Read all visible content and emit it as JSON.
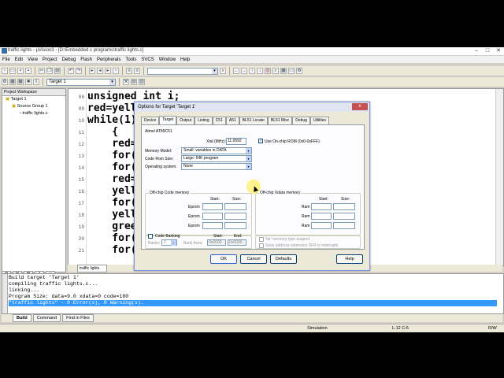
{
  "window": {
    "title": "traffic lights - µVision3 - [D:\\Embedded c programs\\traffic lights.c]"
  },
  "menu": [
    "File",
    "Edit",
    "View",
    "Project",
    "Debug",
    "Flash",
    "Peripherals",
    "Tools",
    "SVCS",
    "Window",
    "Help"
  ],
  "toolbar": {
    "target": "Target 1"
  },
  "workspace": {
    "title": "Project Workspace",
    "tree": [
      "Target 1",
      "Source Group 1",
      "traffic lights.c"
    ]
  },
  "editor": {
    "tab": "traffic lights",
    "lines": [
      {
        "num": "08",
        "text": "unsigned int i;"
      },
      {
        "num": "09",
        "text": "red=yell"
      },
      {
        "num": "10",
        "text": "while(1)"
      },
      {
        "num": "11",
        "text": "    {"
      },
      {
        "num": "12",
        "text": "    red="
      },
      {
        "num": "13",
        "text": "    for("
      },
      {
        "num": "14",
        "text": "    for("
      },
      {
        "num": "15",
        "text": "    red="
      },
      {
        "num": "16",
        "text": "    yell"
      },
      {
        "num": "17",
        "text": "    for("
      },
      {
        "num": "18",
        "text": "    yell"
      },
      {
        "num": "19",
        "text": "    gree"
      },
      {
        "num": "20",
        "text": "    for("
      },
      {
        "num": "21",
        "text": "    for("
      }
    ]
  },
  "output": {
    "lines": [
      "Build target 'Target 1'",
      "compiling traffic lights.c...",
      "linking...",
      "Program Size: data=9.0 xdata=0 code=180",
      "\"traffic lights\" - 0 Error(s), 0 Warning(s)."
    ],
    "tabs": [
      "Build",
      "Command",
      "Find in Files"
    ]
  },
  "status": {
    "mode": "Simulation",
    "pos": "L:12 C:6",
    "extra": "R/W"
  },
  "dialog": {
    "title": "Options for Target 'Target 1'",
    "close": "x",
    "tabs": [
      "Device",
      "Target",
      "Output",
      "Listing",
      "C51",
      "A51",
      "BL51 Locate",
      "BL51 Misc",
      "Debug",
      "Utilities"
    ],
    "active_tab": "Target",
    "device": "Atmel AT89C51",
    "xtal_label": "Xtal (MHz):",
    "xtal_value": "11.0592",
    "onchip_rom": "Use On-chip ROM (0x0-0xFFF)",
    "memory_model_label": "Memory Model:",
    "memory_model": "Small: variables in DATA",
    "code_rom_label": "Code Rom Size:",
    "code_rom": "Large: 64K program",
    "os_label": "Operating system:",
    "os": "None",
    "offchip_code": "Off-chip Code memory",
    "offchip_xdata": "Off-chip Xdata memory",
    "start": "Start:",
    "size": "Size:",
    "eprom": "Eprom",
    "ram": "Ram",
    "code_banking": "Code Banking",
    "banks_label": "Banks:",
    "banks_value": "2",
    "bank_area_label": "Bank Area:",
    "bank_start": "0x0000",
    "bank_end": "0x0000",
    "end": "End:",
    "far_memory": "'far' memory type support",
    "save_address": "Save address extension SFR in interrupts",
    "buttons": {
      "ok": "OK",
      "cancel": "Cancel",
      "defaults": "Defaults",
      "help": "Help"
    }
  },
  "colors": {
    "selection": "#3399ff",
    "dialog_border": "#7a96df"
  }
}
